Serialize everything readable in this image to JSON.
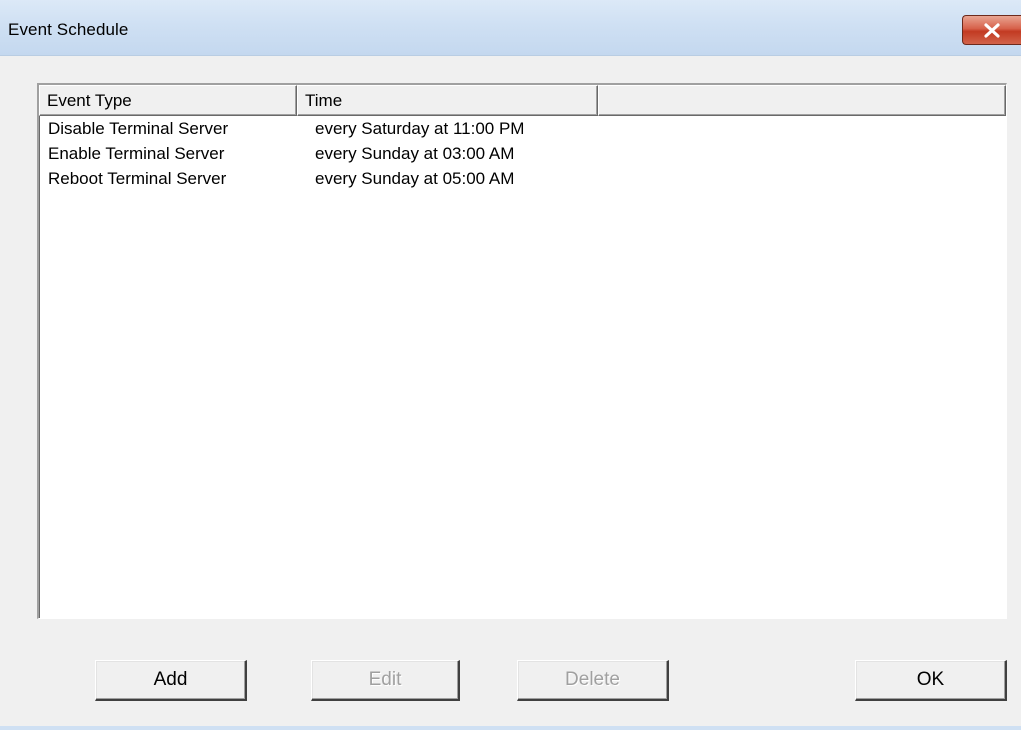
{
  "window": {
    "title": "Event Schedule",
    "close_icon": "close-icon"
  },
  "listview": {
    "columns": [
      "Event Type",
      "Time",
      ""
    ],
    "rows": [
      {
        "type": "Disable Terminal Server",
        "time": "every Saturday at 11:00 PM"
      },
      {
        "type": "Enable Terminal Server",
        "time": "every Sunday at 03:00 AM"
      },
      {
        "type": "Reboot Terminal Server",
        "time": "every Sunday at 05:00 AM"
      }
    ]
  },
  "buttons": {
    "add": "Add",
    "edit": "Edit",
    "delete": "Delete",
    "ok": "OK"
  },
  "colors": {
    "close_button": "#c74a31",
    "titlebar": "#cfe0f3",
    "dialog_bg": "#f0f0f0",
    "disabled_text": "#a0a0a0"
  }
}
